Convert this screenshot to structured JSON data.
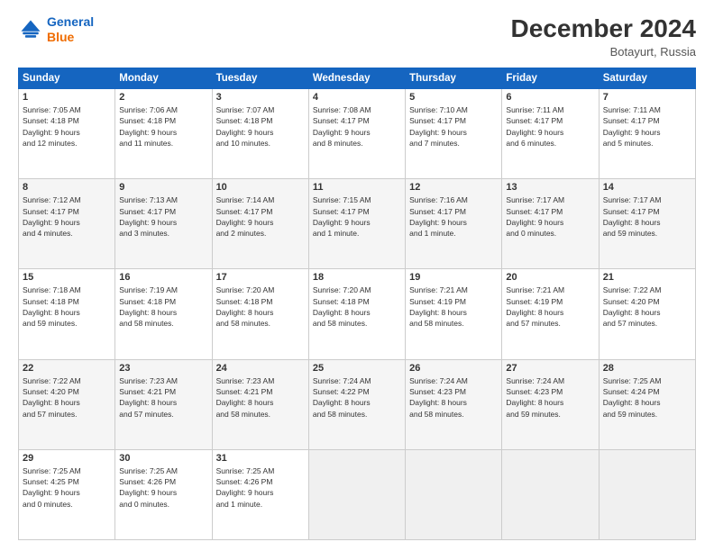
{
  "header": {
    "logo_line1": "General",
    "logo_line2": "Blue",
    "month": "December 2024",
    "location": "Botayurt, Russia"
  },
  "weekdays": [
    "Sunday",
    "Monday",
    "Tuesday",
    "Wednesday",
    "Thursday",
    "Friday",
    "Saturday"
  ],
  "weeks": [
    [
      {
        "day": "1",
        "lines": [
          "Sunrise: 7:05 AM",
          "Sunset: 4:18 PM",
          "Daylight: 9 hours",
          "and 12 minutes."
        ]
      },
      {
        "day": "2",
        "lines": [
          "Sunrise: 7:06 AM",
          "Sunset: 4:18 PM",
          "Daylight: 9 hours",
          "and 11 minutes."
        ]
      },
      {
        "day": "3",
        "lines": [
          "Sunrise: 7:07 AM",
          "Sunset: 4:18 PM",
          "Daylight: 9 hours",
          "and 10 minutes."
        ]
      },
      {
        "day": "4",
        "lines": [
          "Sunrise: 7:08 AM",
          "Sunset: 4:17 PM",
          "Daylight: 9 hours",
          "and 8 minutes."
        ]
      },
      {
        "day": "5",
        "lines": [
          "Sunrise: 7:10 AM",
          "Sunset: 4:17 PM",
          "Daylight: 9 hours",
          "and 7 minutes."
        ]
      },
      {
        "day": "6",
        "lines": [
          "Sunrise: 7:11 AM",
          "Sunset: 4:17 PM",
          "Daylight: 9 hours",
          "and 6 minutes."
        ]
      },
      {
        "day": "7",
        "lines": [
          "Sunrise: 7:11 AM",
          "Sunset: 4:17 PM",
          "Daylight: 9 hours",
          "and 5 minutes."
        ]
      }
    ],
    [
      {
        "day": "8",
        "lines": [
          "Sunrise: 7:12 AM",
          "Sunset: 4:17 PM",
          "Daylight: 9 hours",
          "and 4 minutes."
        ]
      },
      {
        "day": "9",
        "lines": [
          "Sunrise: 7:13 AM",
          "Sunset: 4:17 PM",
          "Daylight: 9 hours",
          "and 3 minutes."
        ]
      },
      {
        "day": "10",
        "lines": [
          "Sunrise: 7:14 AM",
          "Sunset: 4:17 PM",
          "Daylight: 9 hours",
          "and 2 minutes."
        ]
      },
      {
        "day": "11",
        "lines": [
          "Sunrise: 7:15 AM",
          "Sunset: 4:17 PM",
          "Daylight: 9 hours",
          "and 1 minute."
        ]
      },
      {
        "day": "12",
        "lines": [
          "Sunrise: 7:16 AM",
          "Sunset: 4:17 PM",
          "Daylight: 9 hours",
          "and 1 minute."
        ]
      },
      {
        "day": "13",
        "lines": [
          "Sunrise: 7:17 AM",
          "Sunset: 4:17 PM",
          "Daylight: 9 hours",
          "and 0 minutes."
        ]
      },
      {
        "day": "14",
        "lines": [
          "Sunrise: 7:17 AM",
          "Sunset: 4:17 PM",
          "Daylight: 8 hours",
          "and 59 minutes."
        ]
      }
    ],
    [
      {
        "day": "15",
        "lines": [
          "Sunrise: 7:18 AM",
          "Sunset: 4:18 PM",
          "Daylight: 8 hours",
          "and 59 minutes."
        ]
      },
      {
        "day": "16",
        "lines": [
          "Sunrise: 7:19 AM",
          "Sunset: 4:18 PM",
          "Daylight: 8 hours",
          "and 58 minutes."
        ]
      },
      {
        "day": "17",
        "lines": [
          "Sunrise: 7:20 AM",
          "Sunset: 4:18 PM",
          "Daylight: 8 hours",
          "and 58 minutes."
        ]
      },
      {
        "day": "18",
        "lines": [
          "Sunrise: 7:20 AM",
          "Sunset: 4:18 PM",
          "Daylight: 8 hours",
          "and 58 minutes."
        ]
      },
      {
        "day": "19",
        "lines": [
          "Sunrise: 7:21 AM",
          "Sunset: 4:19 PM",
          "Daylight: 8 hours",
          "and 58 minutes."
        ]
      },
      {
        "day": "20",
        "lines": [
          "Sunrise: 7:21 AM",
          "Sunset: 4:19 PM",
          "Daylight: 8 hours",
          "and 57 minutes."
        ]
      },
      {
        "day": "21",
        "lines": [
          "Sunrise: 7:22 AM",
          "Sunset: 4:20 PM",
          "Daylight: 8 hours",
          "and 57 minutes."
        ]
      }
    ],
    [
      {
        "day": "22",
        "lines": [
          "Sunrise: 7:22 AM",
          "Sunset: 4:20 PM",
          "Daylight: 8 hours",
          "and 57 minutes."
        ]
      },
      {
        "day": "23",
        "lines": [
          "Sunrise: 7:23 AM",
          "Sunset: 4:21 PM",
          "Daylight: 8 hours",
          "and 57 minutes."
        ]
      },
      {
        "day": "24",
        "lines": [
          "Sunrise: 7:23 AM",
          "Sunset: 4:21 PM",
          "Daylight: 8 hours",
          "and 58 minutes."
        ]
      },
      {
        "day": "25",
        "lines": [
          "Sunrise: 7:24 AM",
          "Sunset: 4:22 PM",
          "Daylight: 8 hours",
          "and 58 minutes."
        ]
      },
      {
        "day": "26",
        "lines": [
          "Sunrise: 7:24 AM",
          "Sunset: 4:23 PM",
          "Daylight: 8 hours",
          "and 58 minutes."
        ]
      },
      {
        "day": "27",
        "lines": [
          "Sunrise: 7:24 AM",
          "Sunset: 4:23 PM",
          "Daylight: 8 hours",
          "and 59 minutes."
        ]
      },
      {
        "day": "28",
        "lines": [
          "Sunrise: 7:25 AM",
          "Sunset: 4:24 PM",
          "Daylight: 8 hours",
          "and 59 minutes."
        ]
      }
    ],
    [
      {
        "day": "29",
        "lines": [
          "Sunrise: 7:25 AM",
          "Sunset: 4:25 PM",
          "Daylight: 9 hours",
          "and 0 minutes."
        ]
      },
      {
        "day": "30",
        "lines": [
          "Sunrise: 7:25 AM",
          "Sunset: 4:26 PM",
          "Daylight: 9 hours",
          "and 0 minutes."
        ]
      },
      {
        "day": "31",
        "lines": [
          "Sunrise: 7:25 AM",
          "Sunset: 4:26 PM",
          "Daylight: 9 hours",
          "and 1 minute."
        ]
      },
      null,
      null,
      null,
      null
    ]
  ]
}
